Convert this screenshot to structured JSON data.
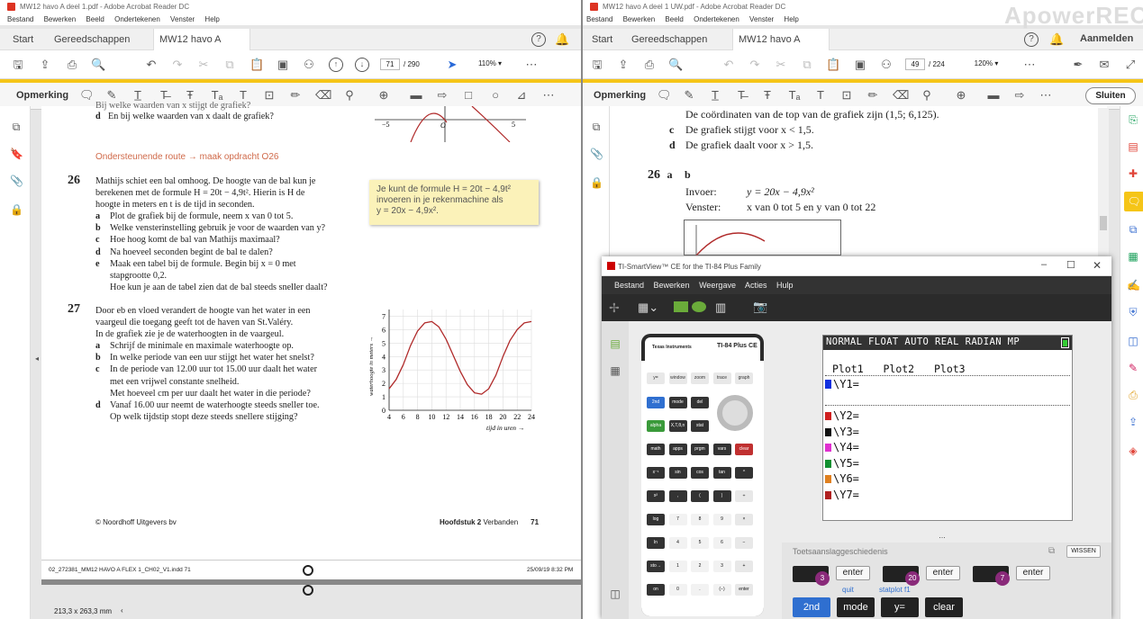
{
  "left": {
    "window_title": "MW12 havo A deel 1.pdf - Adobe Acrobat Reader DC",
    "menu": [
      "Bestand",
      "Bewerken",
      "Beeld",
      "Ondertekenen",
      "Venster",
      "Help"
    ],
    "tabs": {
      "start": "Start",
      "tools": "Gereedschappen",
      "doc": "MW12 havo A deel..."
    },
    "page_current": "71",
    "page_total": "/ 290",
    "zoom": "110%",
    "annot_label": "Opmerking",
    "content": {
      "top_d": "d",
      "top_d_text": "En bij welke waarden van x daalt de grafiek?",
      "top_c_text": "Bij welke waarden van x stijgt de grafiek?",
      "axis_m5": "−5",
      "axis_o": "O",
      "axis_5": "5",
      "axis_x": "x",
      "route": "Ondersteunende route → maak opdracht O26",
      "ex26_num": "26",
      "ex26_lines": [
        "Mathijs schiet een bal omhoog. De hoogte van de bal kun je",
        "berekenen met de formule H = 20t − 4,9t². Hierin is H de",
        "hoogte in meters en t is de tijd in seconden."
      ],
      "ex26_items": [
        {
          "l": "a",
          "t": "Plot de grafiek bij de formule, neem x van 0 tot 5."
        },
        {
          "l": "b",
          "t": "Welke vensterinstelling gebruik je voor de waarden van y?"
        },
        {
          "l": "c",
          "t": "Hoe hoog komt de bal van Mathijs maximaal?"
        },
        {
          "l": "d",
          "t": "Na hoeveel seconden begint de bal te dalen?"
        },
        {
          "l": "e",
          "t": "Maak een tabel bij de formule. Begin bij x = 0 met"
        }
      ],
      "ex26_e2": "stapgrootte 0,2.",
      "ex26_e3": "Hoe kun je aan de tabel zien dat de bal steeds sneller daalt?",
      "tip": [
        "Je kunt de formule H = 20t − 4,9t²",
        "invoeren in je rekenmachine als",
        "y = 20x − 4,9x²."
      ],
      "ex27_num": "27",
      "ex27_lines": [
        "Door eb en vloed verandert de hoogte van het water in een",
        "vaargeul die toegang geeft tot de haven van St.Valéry.",
        "In de grafiek zie je de waterhoogten in de vaargeul."
      ],
      "ex27_items": [
        {
          "l": "a",
          "t": "Schrijf de minimale en maximale waterhoogte op."
        },
        {
          "l": "b",
          "t": "In welke periode van een uur stijgt het water het snelst?"
        },
        {
          "l": "c",
          "t": "In de periode van 12.00 uur tot 15.00 uur daalt het water"
        }
      ],
      "ex27_c2": "met een vrijwel constante snelheid.",
      "ex27_c3": "Met hoeveel cm per uur daalt het water in die periode?",
      "ex27_d": {
        "l": "d",
        "t": "Vanaf 16.00 uur neemt de waterhoogte steeds sneller toe."
      },
      "ex27_d2": "Op welk tijdstip stopt deze steeds snellere stijging?",
      "footer_left": "© Noordhoff Uitgevers bv",
      "footer_chapter": "Hoofdstuk 2",
      "footer_chapter2": "Verbanden",
      "footer_page": "71",
      "print_left": "02_272381_MM12 HAVO A FLEX 1_CH02_V1.indd  71",
      "print_right": "25/09/19   8:32 PM",
      "status_size": "213,3 x 263,3 mm"
    }
  },
  "chart_data": {
    "type": "line",
    "xlabel": "tijd in uren →",
    "ylabel": "waterhoogte in meters →",
    "x_ticks": [
      "4",
      "6",
      "8",
      "10",
      "12",
      "14",
      "16",
      "18",
      "20",
      "22",
      "24"
    ],
    "y_ticks": [
      "0",
      "1",
      "2",
      "3",
      "4",
      "5",
      "6",
      "7"
    ],
    "xlim": [
      4,
      24
    ],
    "ylim": [
      0,
      7.5
    ],
    "x": [
      4,
      5,
      6,
      7,
      8,
      9,
      10,
      11,
      12,
      13,
      14,
      15,
      16,
      17,
      18,
      19,
      20,
      21,
      22,
      23,
      24
    ],
    "y": [
      1.6,
      2.3,
      3.4,
      4.8,
      5.9,
      6.5,
      6.6,
      6.2,
      5.3,
      4.1,
      2.9,
      1.9,
      1.3,
      1.2,
      1.6,
      2.6,
      4.0,
      5.2,
      6.0,
      6.5,
      6.6
    ],
    "color": "#b02a2a"
  },
  "right": {
    "window_title": "MW12 havo A deel 1 UW.pdf - Adobe Acrobat Reader DC",
    "watermark": "ApowerREC",
    "menu": [
      "Bestand",
      "Bewerken",
      "Beeld",
      "Ondertekenen",
      "Venster",
      "Help"
    ],
    "tabs": {
      "start": "Start",
      "tools": "Gereedschappen",
      "doc": "MW12 havo A deel...",
      "login": "Aanmelden"
    },
    "page_current": "49",
    "page_total": "/ 224",
    "zoom": "120%",
    "annot_label": "Opmerking",
    "close_label": "Sluiten",
    "content": {
      "line1": "De coördinaten van de top van de grafiek zijn (1,5; 6,125).",
      "c": "c",
      "c_text": "De grafiek stijgt voor x < 1,5.",
      "d": "d",
      "d_text": "De grafiek daalt voor x > 1,5.",
      "num": "26",
      "a": "a",
      "b": "b",
      "invoer_label": "Invoer:",
      "invoer_val": "y = 20x − 4,9x²",
      "venster_label": "Venster:",
      "venster_val": "x van 0 tot 5 en y van 0 tot 22"
    }
  },
  "ti": {
    "title": "TI-SmartView™ CE for the TI-84 Plus Family",
    "menu": [
      "Bestand",
      "Bewerken",
      "Weergave",
      "Acties",
      "Hulp"
    ],
    "brand": "Texas Instruments",
    "model": "TI-84 Plus CE",
    "status": "NORMAL FLOAT AUTO REAL RADIAN MP",
    "plots": [
      "Plot1",
      "Plot2",
      "Plot3"
    ],
    "y_rows": [
      "\\Y1=",
      "\\Y2=",
      "\\Y3=",
      "\\Y4=",
      "\\Y5=",
      "\\Y6=",
      "\\Y7="
    ],
    "y_colors": [
      "#1030e0",
      "#d02020",
      "#111111",
      "#e030d0",
      "#109030",
      "#e08020",
      "#b02020"
    ],
    "history_label": "Toetsaanslaggeschiedenis",
    "wissen": "WISSEN",
    "history_keys": [
      {
        "badge": "3",
        "label": "enter"
      },
      {
        "badge": "20",
        "label": "enter"
      },
      {
        "badge": "7",
        "label": "enter"
      }
    ],
    "bottom_keys": [
      {
        "top": "",
        "label": "2nd",
        "color": "#2f6fd0"
      },
      {
        "top": "quit",
        "label": "mode",
        "color": "#222"
      },
      {
        "top": "statplot  f1",
        "label": "y=",
        "color": "#222"
      },
      {
        "top": "",
        "label": "clear",
        "color": "#222"
      }
    ],
    "keys_row1": [
      "y=",
      "window",
      "zoom",
      "trace",
      "graph"
    ],
    "keys_row2": [
      "2nd",
      "mode",
      "del"
    ],
    "keys_row3": [
      "alpha",
      "X,T,θ,n",
      "stat"
    ],
    "keys_row4": [
      "math",
      "apps",
      "prgm",
      "vars",
      "clear"
    ],
    "keys_row5": [
      "x⁻¹",
      "sin",
      "cos",
      "tan",
      "^"
    ],
    "keys_row6": [
      "x²",
      ",",
      "(",
      ")",
      "÷"
    ],
    "keys_row7": [
      "log",
      "7",
      "8",
      "9",
      "×"
    ],
    "keys_row8": [
      "ln",
      "4",
      "5",
      "6",
      "−"
    ],
    "keys_row9": [
      "sto→",
      "1",
      "2",
      "3",
      "+"
    ],
    "keys_row10": [
      "on",
      "0",
      ".",
      "(−)",
      "enter"
    ]
  }
}
